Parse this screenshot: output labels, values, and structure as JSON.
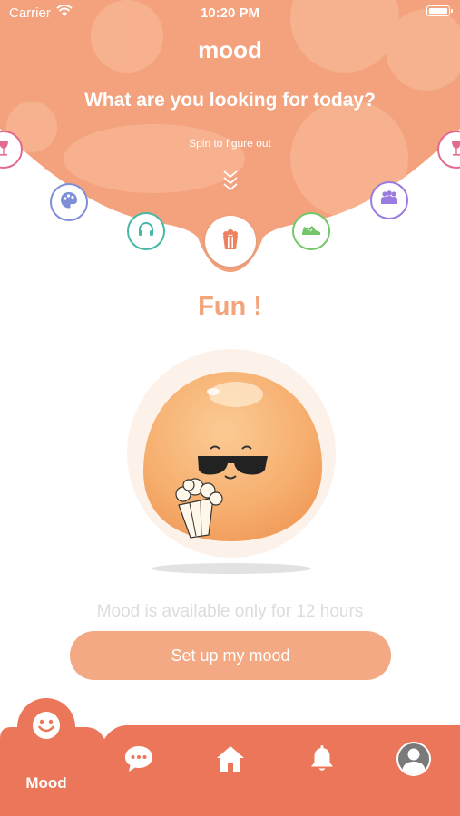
{
  "status_bar": {
    "carrier": "Carrier",
    "time": "10:20 PM"
  },
  "header": {
    "title": "mood",
    "question": "What are you looking for today?",
    "spin_hint": "Spin to figure out"
  },
  "wheel": {
    "items": [
      {
        "name": "drinks",
        "icon": "wine-glass-icon",
        "color": "#E06B8E"
      },
      {
        "name": "art",
        "icon": "palette-icon",
        "color": "#7E8FD8"
      },
      {
        "name": "music",
        "icon": "headphones-icon",
        "color": "#48B8A4"
      },
      {
        "name": "fun",
        "icon": "popcorn-icon",
        "color": "#EC8260",
        "selected": true
      },
      {
        "name": "sports",
        "icon": "sneaker-icon",
        "color": "#74C66A"
      },
      {
        "name": "social",
        "icon": "people-icon",
        "color": "#9B7BE0"
      },
      {
        "name": "drinks",
        "icon": "wine-glass-icon",
        "color": "#E06B8E"
      }
    ]
  },
  "main": {
    "mood_name": "Fun !",
    "availability": "Mood is available only for 12 hours",
    "cta_label": "Set up my mood"
  },
  "tabbar": {
    "items": [
      {
        "label": "Mood",
        "icon": "smiley-icon",
        "active": true
      },
      {
        "label": "",
        "icon": "chat-bubble-icon"
      },
      {
        "label": "",
        "icon": "home-icon"
      },
      {
        "label": "",
        "icon": "bell-icon"
      },
      {
        "label": "",
        "icon": "profile-icon"
      }
    ]
  },
  "colors": {
    "header_bg": "#F4A27D",
    "accent": "#F2A47A",
    "cta": "#F3A983",
    "tabbar": "#EC7659"
  }
}
